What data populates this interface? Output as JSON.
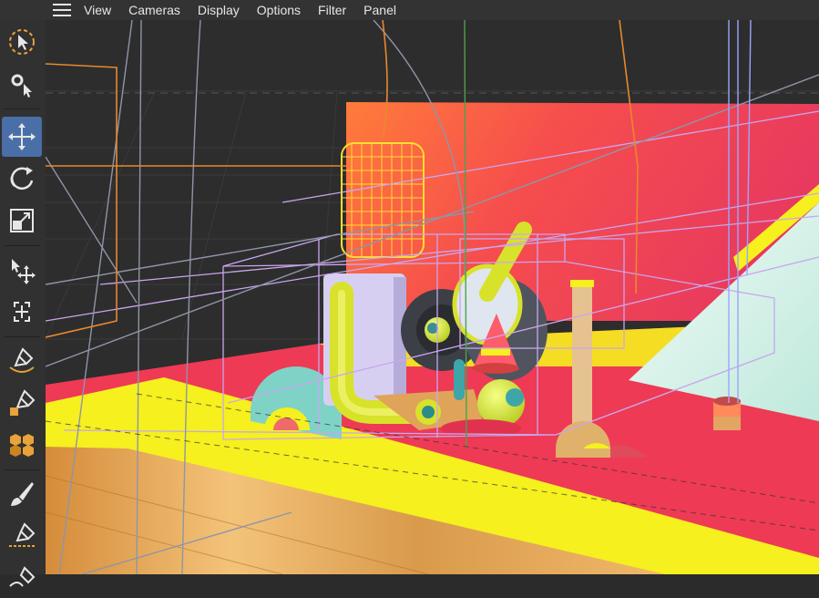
{
  "menu": {
    "items": [
      "View",
      "Cameras",
      "Display",
      "Options",
      "Filter",
      "Panel"
    ]
  },
  "toolbar": {
    "tools": [
      {
        "name": "live-selection-icon",
        "active": false
      },
      {
        "name": "selection-settings-icon",
        "active": false
      },
      {
        "name": "move-icon",
        "active": true
      },
      {
        "name": "rotate-icon",
        "active": false
      },
      {
        "name": "scale-icon",
        "active": false
      },
      {
        "name": "move-axis-icon",
        "active": false
      },
      {
        "name": "scale-axis-icon",
        "active": false
      },
      {
        "name": "spline-pen-icon",
        "active": false
      },
      {
        "name": "spline-point-icon",
        "active": false
      },
      {
        "name": "spline-objects-icon",
        "active": false
      },
      {
        "name": "brush-icon",
        "active": false
      },
      {
        "name": "pen-line-icon",
        "active": false
      }
    ]
  },
  "colors": {
    "accent": "#4a6ea8",
    "background": "#2b2b2b",
    "wall": "#f04a5e",
    "floor_yellow": "#f5f01e",
    "wireframe": "#c9a6ee",
    "camera_line": "#8f95a8"
  }
}
